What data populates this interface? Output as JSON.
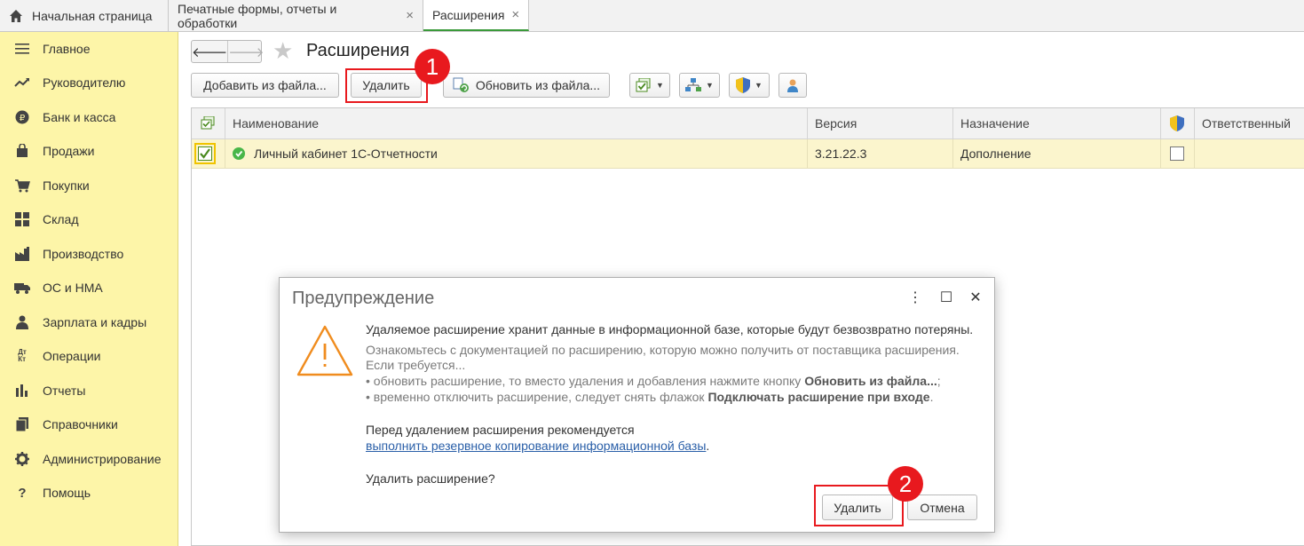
{
  "tabs": [
    {
      "label": "Начальная страница",
      "icon": "home-icon"
    },
    {
      "label": "Печатные формы, отчеты и обработки",
      "close": "×"
    },
    {
      "label": "Расширения",
      "close": "×"
    }
  ],
  "sidebar": {
    "items": [
      {
        "label": "Главное",
        "icon": "menu-lines-icon"
      },
      {
        "label": "Руководителю",
        "icon": "trend-icon"
      },
      {
        "label": "Банк и касса",
        "icon": "coin-icon"
      },
      {
        "label": "Продажи",
        "icon": "bag-icon"
      },
      {
        "label": "Покупки",
        "icon": "cart-icon"
      },
      {
        "label": "Склад",
        "icon": "warehouse-icon"
      },
      {
        "label": "Производство",
        "icon": "factory-icon"
      },
      {
        "label": "ОС и НМА",
        "icon": "truck-icon"
      },
      {
        "label": "Зарплата и кадры",
        "icon": "person-icon"
      },
      {
        "label": "Операции",
        "icon": "dt-kt-icon",
        "glyph": "Дт\nКт"
      },
      {
        "label": "Отчеты",
        "icon": "bar-chart-icon"
      },
      {
        "label": "Справочники",
        "icon": "books-icon"
      },
      {
        "label": "Администрирование",
        "icon": "gear-icon"
      },
      {
        "label": "Помощь",
        "icon": "question-icon",
        "glyph": "?"
      }
    ]
  },
  "header": {
    "title": "Расширения",
    "back": "🡐",
    "forward": "🡒",
    "star": "★"
  },
  "toolbar": {
    "add_label": "Добавить из файла...",
    "delete_label": "Удалить",
    "update_label": "Обновить из файла...",
    "dropdown_glyph": "▼"
  },
  "annotations": {
    "badge1": "1",
    "badge2": "2",
    "accent": "#e8191e"
  },
  "table": {
    "columns": [
      "Наименование",
      "Версия",
      "Назначение",
      "Ответственный"
    ],
    "rows": [
      {
        "name": "Личный кабинет 1С-Отчетности",
        "version": "3.21.22.3",
        "purpose": "Дополнение",
        "active": true,
        "safe_mode": false
      }
    ]
  },
  "dialog": {
    "title": "Предупреждение",
    "menu": "⋮",
    "maximize": "☐",
    "close": "✕",
    "line1": "Удаляемое расширение хранит данные в информационной базе, которые будут безвозвратно потеряны.",
    "line2": "Ознакомьтесь с документацией по расширению, которую можно получить от поставщика расширения.",
    "line3": "Если требуется...",
    "line4_pre": "• обновить расширение, то вместо удаления и добавления нажмите кнопку ",
    "line4_bold": "Обновить из файла...",
    "line4_post": ";",
    "line5_pre": "• временно отключить расширение, следует снять флажок ",
    "line5_bold": "Подключать расширение при входе",
    "line5_post": ".",
    "line6": "Перед удалением расширения рекомендуется",
    "link": "выполнить резервное копирование информационной базы",
    "link_post": ".",
    "question": "Удалить расширение?",
    "delete_label": "Удалить",
    "cancel_label": "Отмена"
  }
}
